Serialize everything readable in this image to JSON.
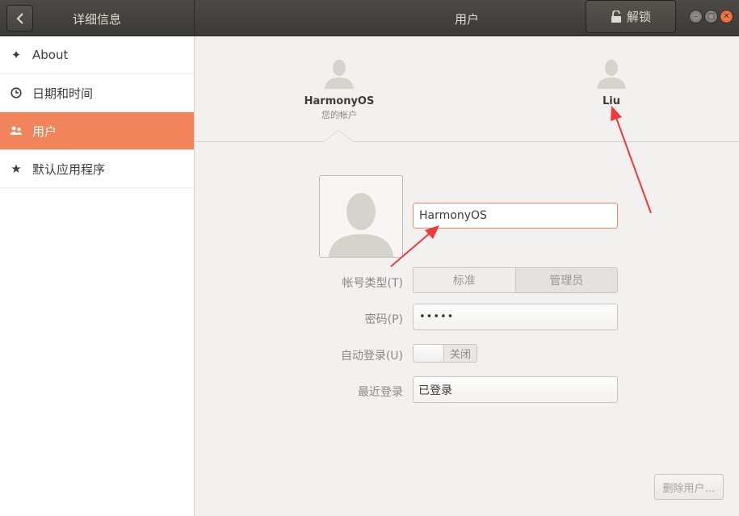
{
  "header": {
    "left_title": "详细信息",
    "title": "用户",
    "unlock_label": "解锁"
  },
  "sidebar": {
    "items": [
      {
        "label": "About",
        "icon": "sparkle-icon",
        "active": false
      },
      {
        "label": "日期和时间",
        "icon": "clock-icon",
        "active": false
      },
      {
        "label": "用户",
        "icon": "users-icon",
        "active": true
      },
      {
        "label": "默认应用程序",
        "icon": "star-icon",
        "active": false
      }
    ]
  },
  "users": [
    {
      "name": "HarmonyOS",
      "subtitle": "您的帐户",
      "selected": true
    },
    {
      "name": "Liu",
      "subtitle": "",
      "selected": false
    }
  ],
  "detail": {
    "full_name": "HarmonyOS",
    "account_type_label": "帐号类型(T)",
    "account_type_options": [
      "标准",
      "管理员"
    ],
    "password_label": "密码(P)",
    "password_value": "•••••",
    "autologin_label": "自动登录(U)",
    "autologin_state": "关闭",
    "last_login_label": "最近登录",
    "last_login_value": "已登录",
    "remove_button": "删除用户…"
  },
  "colors": {
    "accent": "#f2845b",
    "header_bg": "#3f3e3a",
    "annotation": "#f03a3a"
  }
}
